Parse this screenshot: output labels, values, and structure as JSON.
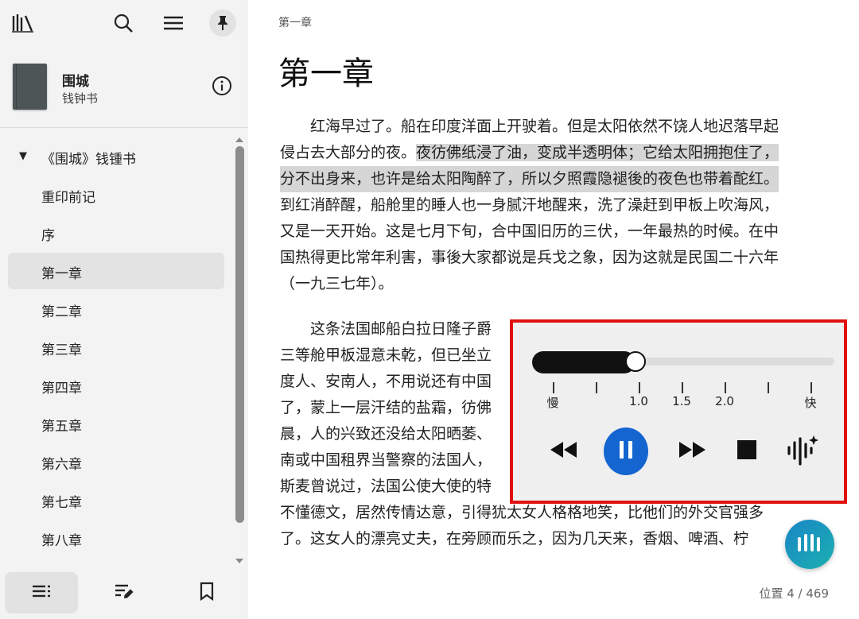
{
  "sidebar": {
    "book": {
      "title": "围城",
      "author": "钱钟书"
    },
    "toc": [
      {
        "label": "《围城》钱锺书"
      },
      {
        "label": "重印前记"
      },
      {
        "label": "序"
      },
      {
        "label": "第一章"
      },
      {
        "label": "第二章"
      },
      {
        "label": "第三章"
      },
      {
        "label": "第四章"
      },
      {
        "label": "第五章"
      },
      {
        "label": "第六章"
      },
      {
        "label": "第七章"
      },
      {
        "label": "第八章"
      }
    ],
    "selected_index": 3,
    "icons": [
      "library-icon",
      "search-icon",
      "menu-icon",
      "pin-icon",
      "info-icon",
      "toc-icon",
      "notes-icon",
      "bookmark-icon"
    ]
  },
  "reader": {
    "header": "第一章",
    "chapter_title": "第一章",
    "para1": [
      "　　红海早过了。船在印度洋面上开驶着。但是太阳依然不饶人地迟落早起",
      "侵占去大部分的夜。",
      "夜彷佛纸浸了油，变成半透明体；它给太阳拥抱住了，",
      "分不出身来，也许是给太阳陶醉了，所以夕照霞隐褪後的夜色也带着酡红。",
      "到红消醉醒，船舱里的睡人也一身腻汗地醒来，洗了澡赶到甲板上吹海风，",
      "又是一天开始。这是七月下旬，合中国旧历的三伏，一年最热的时候。在中",
      "国热得更比常年利害，事後大家都说是兵戈之象，因为这就是民国二十六年",
      "（一九三七年）。"
    ],
    "para2": [
      "　　这条法国邮船白拉日隆子爵",
      "三等舱甲板湿意未乾，但已坐立",
      "度人、安南人，不用说还有中国",
      "了，蒙上一层汗结的盐霜，彷佛",
      "晨，人的兴致还没给太阳晒萎、",
      "南或中国租界当警察的法国人，",
      "斯麦曾说过，法国公使大使的特",
      "不懂德文，居然传情达意，引得犹太女人格格地笑，比他们的外交官强多",
      "了。这女人的漂亮丈夫，在旁顾而乐之，因为几天来，香烟、啤酒、柠"
    ],
    "position_text": "位置 4 / 469"
  },
  "tts_panel": {
    "speed_labels": [
      "慢",
      "1.0",
      "1.5",
      "2.0",
      "快"
    ],
    "speed_value": 1.0,
    "slider_fraction": 0.35,
    "accent": "#1565d0",
    "highlight_color": "#e01111"
  }
}
